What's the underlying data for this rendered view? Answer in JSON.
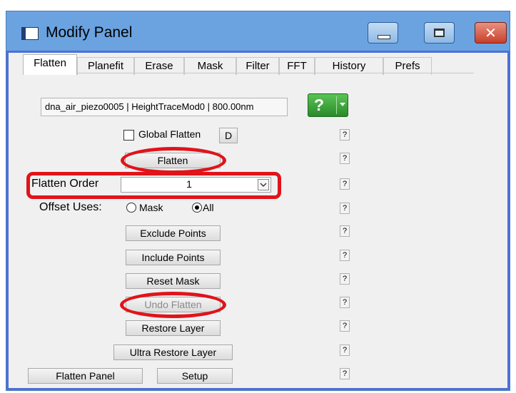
{
  "window": {
    "title": "Modify Panel",
    "close_glyph": "✕",
    "icons": [
      "app-icon",
      "minimize-icon",
      "maximize-icon",
      "close-icon"
    ],
    "accent_color": "#4f6fd6",
    "annotation_color": "#e0141a"
  },
  "tabs": [
    {
      "label": "Flatten",
      "active": true
    },
    {
      "label": "Planefit",
      "active": false
    },
    {
      "label": "Erase",
      "active": false
    },
    {
      "label": "Mask",
      "active": false
    },
    {
      "label": "Filter",
      "active": false
    },
    {
      "label": "FFT",
      "active": false
    },
    {
      "label": "History",
      "active": false
    },
    {
      "label": "Prefs",
      "active": false
    }
  ],
  "header": {
    "path": "dna_air_piezo0005 | HeightTraceMod0 | 800.00nm",
    "help_glyph": "?"
  },
  "flatten": {
    "global_flatten_label": "Global Flatten",
    "global_flatten_checked": false,
    "d_button": "D",
    "flatten_button": "Flatten",
    "order_label": "Flatten Order",
    "order_value": "1",
    "offset_label": "Offset Uses:",
    "offset_mask": "Mask",
    "offset_all": "All",
    "offset_selected": "All",
    "exclude_points": "Exclude Points",
    "include_points": "Include Points",
    "reset_mask": "Reset Mask",
    "undo_flatten": "Undo Flatten",
    "undo_flatten_enabled": false,
    "restore_layer": "Restore Layer",
    "ultra_restore_layer": "Ultra Restore Layer",
    "flatten_panel": "Flatten Panel",
    "setup": "Setup"
  },
  "help_q": "?"
}
